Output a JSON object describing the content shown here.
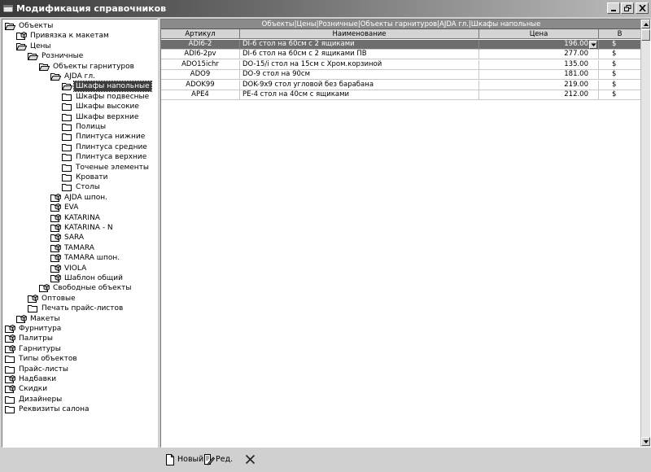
{
  "window": {
    "title": "Модификация справочников"
  },
  "tree": {
    "items": [
      {
        "label": "Объекты",
        "level": 0,
        "icon": "folder-open-icon"
      },
      {
        "label": "Привязка к макетам",
        "level": 1,
        "icon": "cube-folder-icon"
      },
      {
        "label": "Цены",
        "level": 1,
        "icon": "folder-open-icon"
      },
      {
        "label": "Розничные",
        "level": 2,
        "icon": "folder-open-icon"
      },
      {
        "label": "Объекты гарнитуров",
        "level": 3,
        "icon": "folder-open-icon"
      },
      {
        "label": "AJDA гл.",
        "level": 4,
        "icon": "folder-open-icon"
      },
      {
        "label": "Шкафы напольные",
        "level": 5,
        "icon": "folder-open-icon",
        "selected": true
      },
      {
        "label": "Шкафы подвесные",
        "level": 5,
        "icon": "folder-icon"
      },
      {
        "label": "Шкафы высокие",
        "level": 5,
        "icon": "folder-icon"
      },
      {
        "label": "Шкафы верхние",
        "level": 5,
        "icon": "folder-icon"
      },
      {
        "label": "Полицы",
        "level": 5,
        "icon": "folder-icon"
      },
      {
        "label": "Плинтуса нижние",
        "level": 5,
        "icon": "folder-icon"
      },
      {
        "label": "Плинтуса средние",
        "level": 5,
        "icon": "folder-icon"
      },
      {
        "label": "Плинтуса верхние",
        "level": 5,
        "icon": "folder-icon"
      },
      {
        "label": "Точеные элементы",
        "level": 5,
        "icon": "folder-icon"
      },
      {
        "label": "Кровати",
        "level": 5,
        "icon": "folder-icon"
      },
      {
        "label": "Столы",
        "level": 5,
        "icon": "folder-icon"
      },
      {
        "label": "AJDA шпон.",
        "level": 4,
        "icon": "cube-folder-icon"
      },
      {
        "label": "EVA",
        "level": 4,
        "icon": "cube-folder-icon"
      },
      {
        "label": "KATARINA",
        "level": 4,
        "icon": "cube-folder-icon"
      },
      {
        "label": "KATARINA - N",
        "level": 4,
        "icon": "cube-folder-icon"
      },
      {
        "label": "SARA",
        "level": 4,
        "icon": "cube-folder-icon"
      },
      {
        "label": "TAMARA",
        "level": 4,
        "icon": "cube-folder-icon"
      },
      {
        "label": "TAMARA шпон.",
        "level": 4,
        "icon": "cube-folder-icon"
      },
      {
        "label": "VIOLA",
        "level": 4,
        "icon": "cube-folder-icon"
      },
      {
        "label": "Шаблон общий",
        "level": 4,
        "icon": "cube-folder-icon"
      },
      {
        "label": "Свободные объекты",
        "level": 3,
        "icon": "cube-folder-icon"
      },
      {
        "label": "Оптовые",
        "level": 2,
        "icon": "cube-folder-icon"
      },
      {
        "label": "Печать прайс-листов",
        "level": 2,
        "icon": "folder-icon"
      },
      {
        "label": "Макеты",
        "level": 1,
        "icon": "cube-folder-icon"
      },
      {
        "label": "Фурнитура",
        "level": 0,
        "icon": "cube-folder-icon"
      },
      {
        "label": "Палитры",
        "level": 0,
        "icon": "cube-folder-icon"
      },
      {
        "label": "Гарнитуры",
        "level": 0,
        "icon": "cube-folder-icon"
      },
      {
        "label": "Типы объектов",
        "level": 0,
        "icon": "folder-icon"
      },
      {
        "label": "Прайс-листы",
        "level": 0,
        "icon": "folder-icon"
      },
      {
        "label": "Надбавки",
        "level": 0,
        "icon": "cube-folder-icon"
      },
      {
        "label": "Скидки",
        "level": 0,
        "icon": "cube-folder-icon"
      },
      {
        "label": "Дизайнеры",
        "level": 0,
        "icon": "folder-icon"
      },
      {
        "label": "Реквизиты салона",
        "level": 0,
        "icon": "folder-icon"
      }
    ]
  },
  "grid": {
    "caption": "Объекты|Цены|Розничные|Объекты гарнитуров|AJDA гл.|Шкафы напольные",
    "columns": [
      "Артикул",
      "Наименование",
      "Цена",
      "В"
    ],
    "rows": [
      {
        "article": "ADI6-2",
        "name": "DI-6 стол на 60см с 2 ящиками",
        "price": "196.00",
        "currency": "$",
        "selected": true
      },
      {
        "article": "ADI6-2pv",
        "name": "DI-6 стол на 60см с 2 ящиками ПВ",
        "price": "277.00",
        "currency": "$"
      },
      {
        "article": "ADO15ichr",
        "name": "DO-15/i стол на 15см с Хром.корзиной",
        "price": "135.00",
        "currency": "$"
      },
      {
        "article": "ADO9",
        "name": "DO-9 стол на 90см",
        "price": "181.00",
        "currency": "$"
      },
      {
        "article": "ADOK99",
        "name": "DOK-9x9 стол угловой без барабана",
        "price": "219.00",
        "currency": "$"
      },
      {
        "article": "APE4",
        "name": "PE-4 стол на 40см с ящиками",
        "price": "212.00",
        "currency": "$"
      }
    ]
  },
  "toolbar": {
    "new_label": "Новый",
    "edit_label": "Ред.",
    "delete_icon": "close-x-icon"
  }
}
